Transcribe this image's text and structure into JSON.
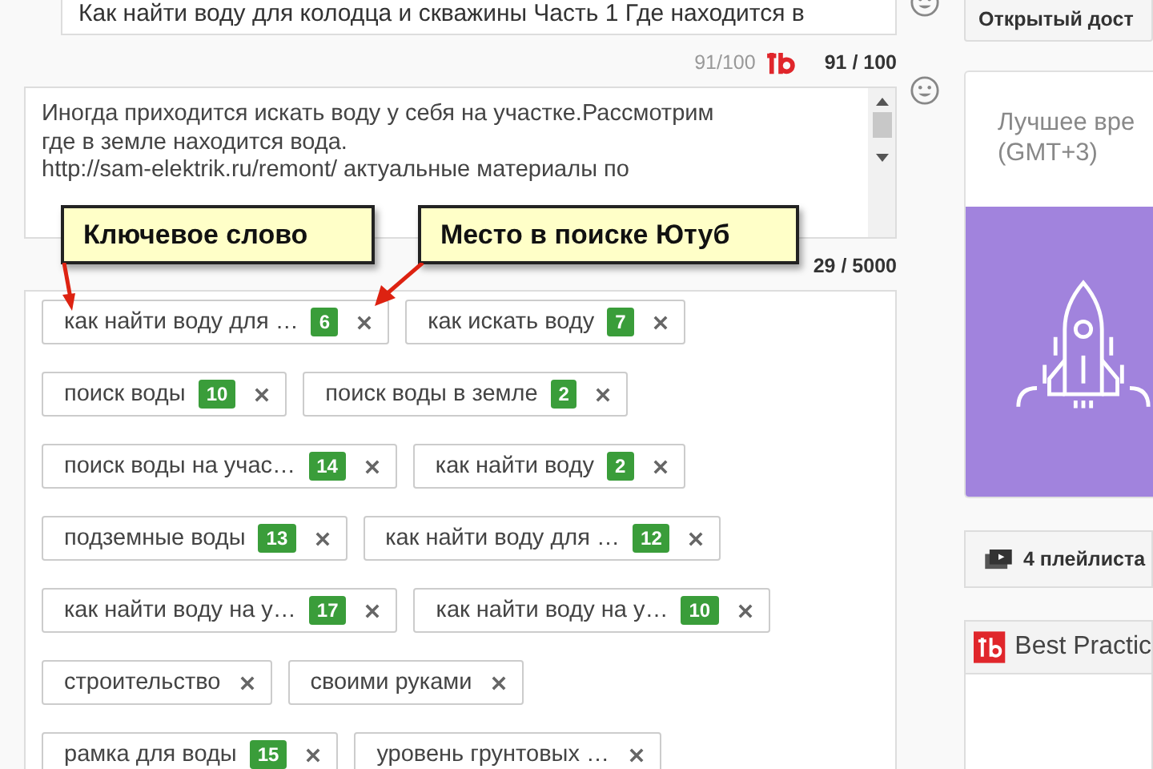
{
  "title_field": {
    "value": "Как найти воду для колодца и скважины  Часть 1 Где находится в",
    "counter_small": "91/100",
    "counter": "91 / 100"
  },
  "description_field": {
    "lines": [
      "Иногда приходится искать воду у себя на участке.Рассмотрим",
      "где в земле находится вода.",
      "http://sam-elektrik.ru/remont/ актуальные материалы по"
    ],
    "counter": "29 / 5000"
  },
  "callouts": [
    {
      "text": "Ключевое слово"
    },
    {
      "text": "Место в поиске Ютуб"
    }
  ],
  "tag_rows": [
    [
      {
        "text": "как найти воду для …",
        "rank": "6"
      },
      {
        "text": "как искать воду",
        "rank": "7"
      }
    ],
    [
      {
        "text": "поиск воды",
        "rank": "10"
      },
      {
        "text": "поиск воды в земле",
        "rank": "2"
      }
    ],
    [
      {
        "text": "поиск воды на учас…",
        "rank": "14"
      },
      {
        "text": "как найти воду",
        "rank": "2"
      }
    ],
    [
      {
        "text": "подземные воды",
        "rank": "13"
      },
      {
        "text": "как найти воду для …",
        "rank": "12"
      }
    ],
    [
      {
        "text": "как найти воду на у…",
        "rank": "17"
      },
      {
        "text": "как найти воду на у…",
        "rank": "10"
      }
    ],
    [
      {
        "text": "строительство"
      },
      {
        "text": "своими руками"
      }
    ],
    [
      {
        "text": "рамка для воды",
        "rank": "15"
      },
      {
        "text": "уровень грунтовых …"
      }
    ]
  ],
  "sidebar": {
    "access_button": "Открытый дост",
    "best_time": {
      "title": "Лучшее вре",
      "timezone": "(GMT+3)"
    },
    "playlists": "4 плейлиста",
    "best_practices": "Best Practic"
  }
}
